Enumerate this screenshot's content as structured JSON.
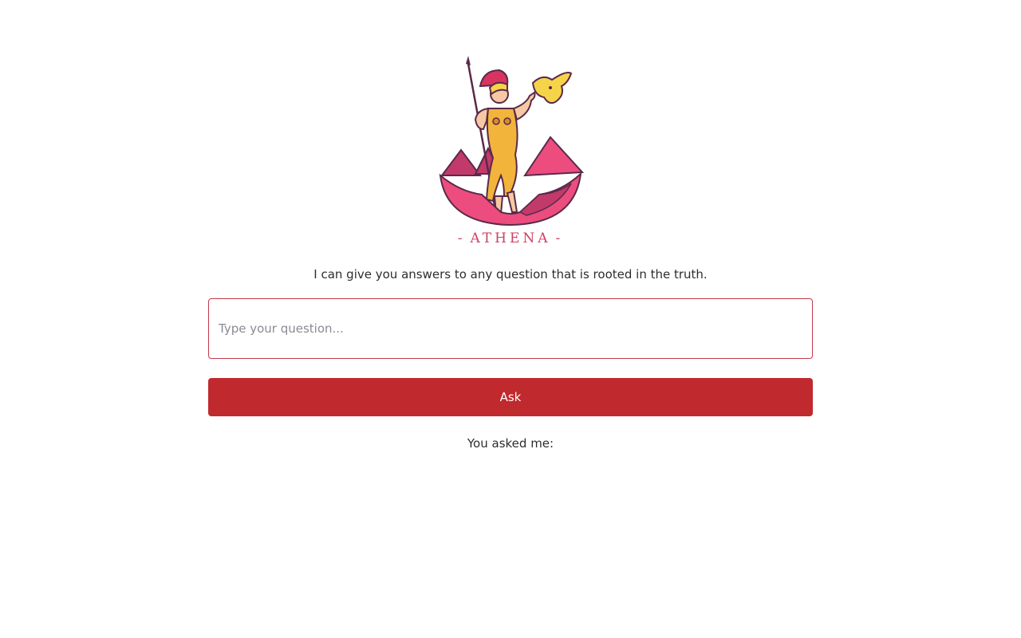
{
  "brand": {
    "name": "ATHENA",
    "dash_left": "-",
    "dash_right": "-"
  },
  "tagline": "I can give you answers to any question that is rooted in the truth.",
  "question": {
    "placeholder": "Type your question...",
    "value": ""
  },
  "ask_button": {
    "label": "Ask"
  },
  "asked_label": "You asked me:",
  "colors": {
    "accent": "#c0292d",
    "input_border": "#c23a4a",
    "brand_text": "#cf3f63",
    "lotus_pink": "#ec4d7e",
    "lotus_dark": "#c23a6a",
    "gown_yellow": "#f2b43a",
    "owl_yellow": "#f5d44a"
  },
  "icons": {
    "logo": "athena-goddess-logo"
  }
}
